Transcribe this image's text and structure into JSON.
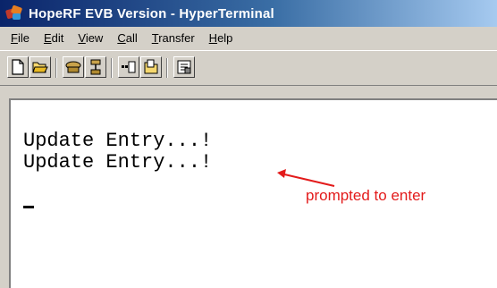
{
  "window": {
    "title": "HopeRF EVB Version - HyperTerminal"
  },
  "menu": {
    "items": [
      {
        "label": "File",
        "underline": "F"
      },
      {
        "label": "Edit",
        "underline": "E"
      },
      {
        "label": "View",
        "underline": "V"
      },
      {
        "label": "Call",
        "underline": "C"
      },
      {
        "label": "Transfer",
        "underline": "T"
      },
      {
        "label": "Help",
        "underline": "H"
      }
    ]
  },
  "toolbar": {
    "buttons": [
      {
        "name": "new-icon"
      },
      {
        "name": "open-icon"
      },
      {
        "name": "connect-icon"
      },
      {
        "name": "disconnect-icon"
      },
      {
        "name": "send-icon"
      },
      {
        "name": "receive-icon"
      },
      {
        "name": "properties-icon"
      }
    ]
  },
  "terminal": {
    "lines": [
      "Update Entry...!",
      "Update Entry...!"
    ]
  },
  "annotation": {
    "text": "prompted to enter",
    "color": "#e31b1b"
  }
}
